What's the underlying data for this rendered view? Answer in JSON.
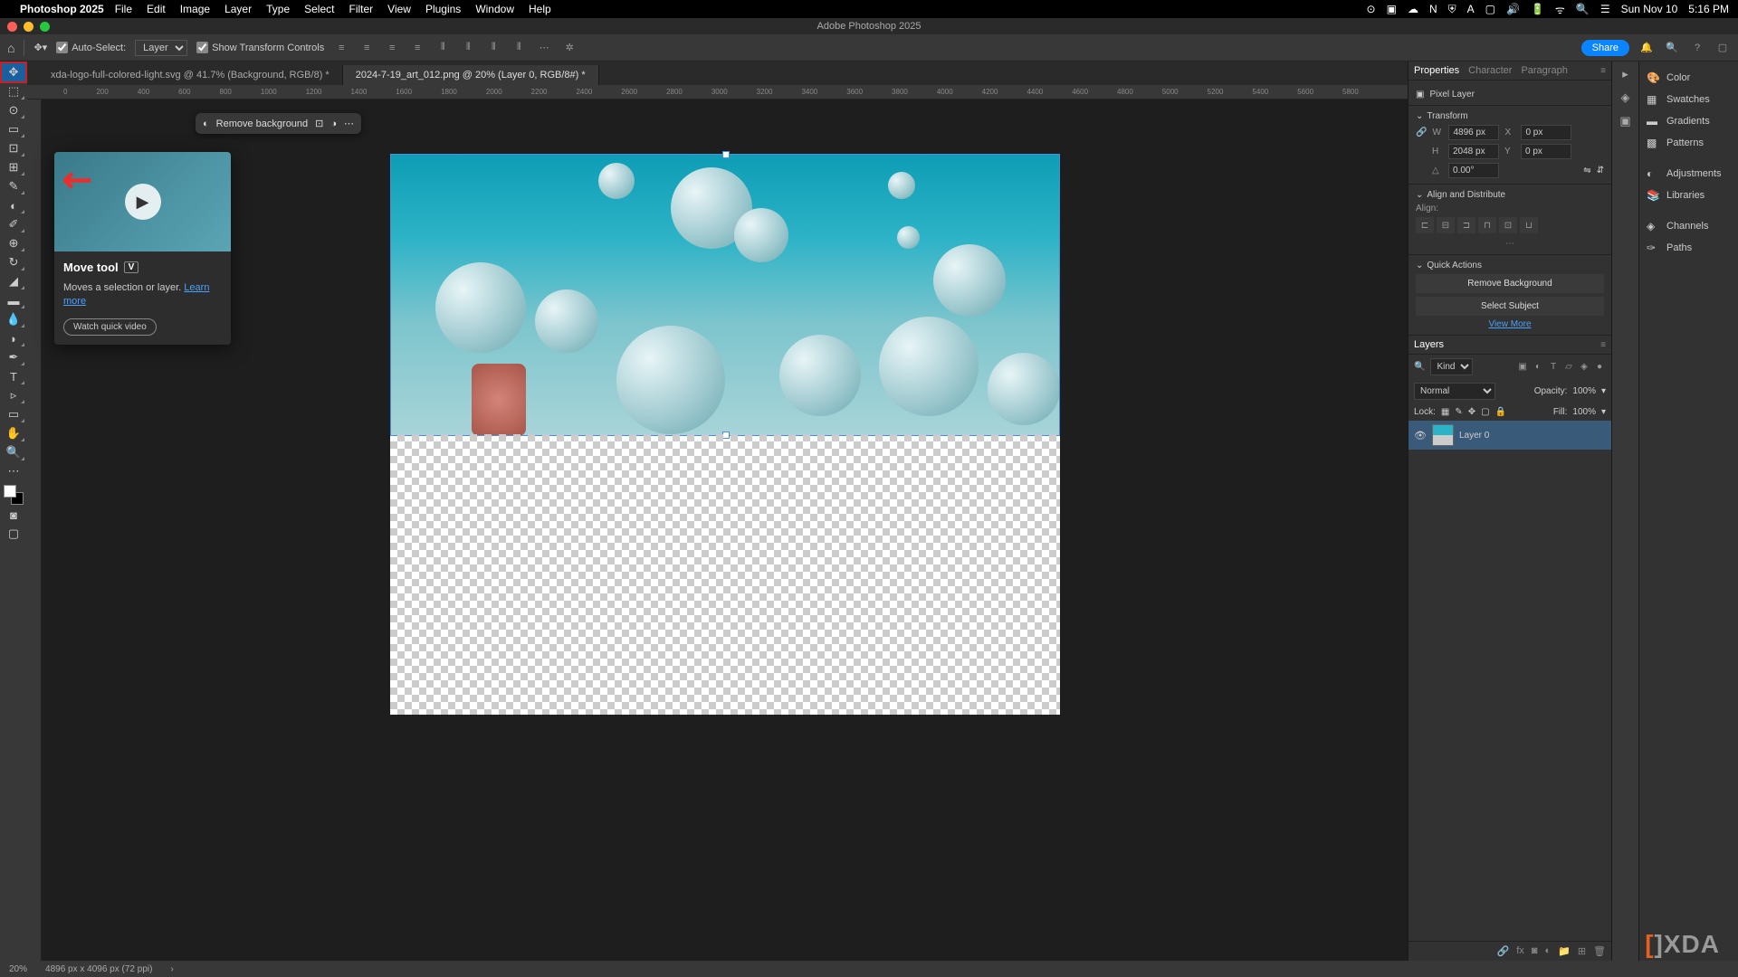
{
  "menubar": {
    "app_name": "Photoshop 2025",
    "items": [
      "File",
      "Edit",
      "Image",
      "Layer",
      "Type",
      "Select",
      "Filter",
      "View",
      "Plugins",
      "Window",
      "Help"
    ],
    "date": "Sun Nov 10",
    "time": "5:16 PM"
  },
  "titlebar": {
    "title": "Adobe Photoshop 2025"
  },
  "options": {
    "auto_select": "Auto-Select:",
    "layer_dd": "Layer",
    "show_transform": "Show Transform Controls",
    "share": "Share"
  },
  "tabs": [
    {
      "label": "xda-logo-full-colored-light.svg @ 41.7% (Background, RGB/8) *",
      "active": false
    },
    {
      "label": "2024-7-19_art_012.png @ 20% (Layer 0, RGB/8#) *",
      "active": true
    }
  ],
  "ruler_marks": [
    "0",
    "200",
    "400",
    "600",
    "800",
    "1000",
    "1200",
    "1400",
    "1600",
    "1800",
    "2000",
    "2200",
    "2400",
    "2600",
    "2800",
    "3000",
    "3200",
    "3400",
    "3600",
    "3800",
    "4000",
    "4200",
    "4400",
    "4600",
    "4800",
    "5000",
    "5200",
    "5400",
    "5600",
    "5800"
  ],
  "context_bar": {
    "remove_bg": "Remove background"
  },
  "tooltip": {
    "title": "Move tool",
    "key": "V",
    "desc": "Moves a selection or layer. ",
    "learn": "Learn more",
    "watch": "Watch quick video"
  },
  "properties": {
    "tabs": [
      "Properties",
      "Character",
      "Paragraph"
    ],
    "pixel_layer": "Pixel Layer",
    "transform": "Transform",
    "w": "4896 px",
    "h": "2048 px",
    "x": "0 px",
    "y": "0 px",
    "angle": "0.00°",
    "align": "Align and Distribute",
    "align_label": "Align:",
    "quick": "Quick Actions",
    "remove_bg": "Remove Background",
    "select_subj": "Select Subject",
    "view_more": "View More"
  },
  "layers": {
    "tab": "Layers",
    "kind": "Kind",
    "blend": "Normal",
    "opacity_label": "Opacity:",
    "opacity": "100%",
    "lock": "Lock:",
    "fill_label": "Fill:",
    "fill": "100%",
    "layer0": "Layer 0"
  },
  "far_right": [
    "Color",
    "Swatches",
    "Gradients",
    "Patterns",
    "Adjustments",
    "Libraries",
    "Channels",
    "Paths"
  ],
  "status": {
    "zoom": "20%",
    "dims": "4896 px x 4096 px (72 ppi)"
  }
}
